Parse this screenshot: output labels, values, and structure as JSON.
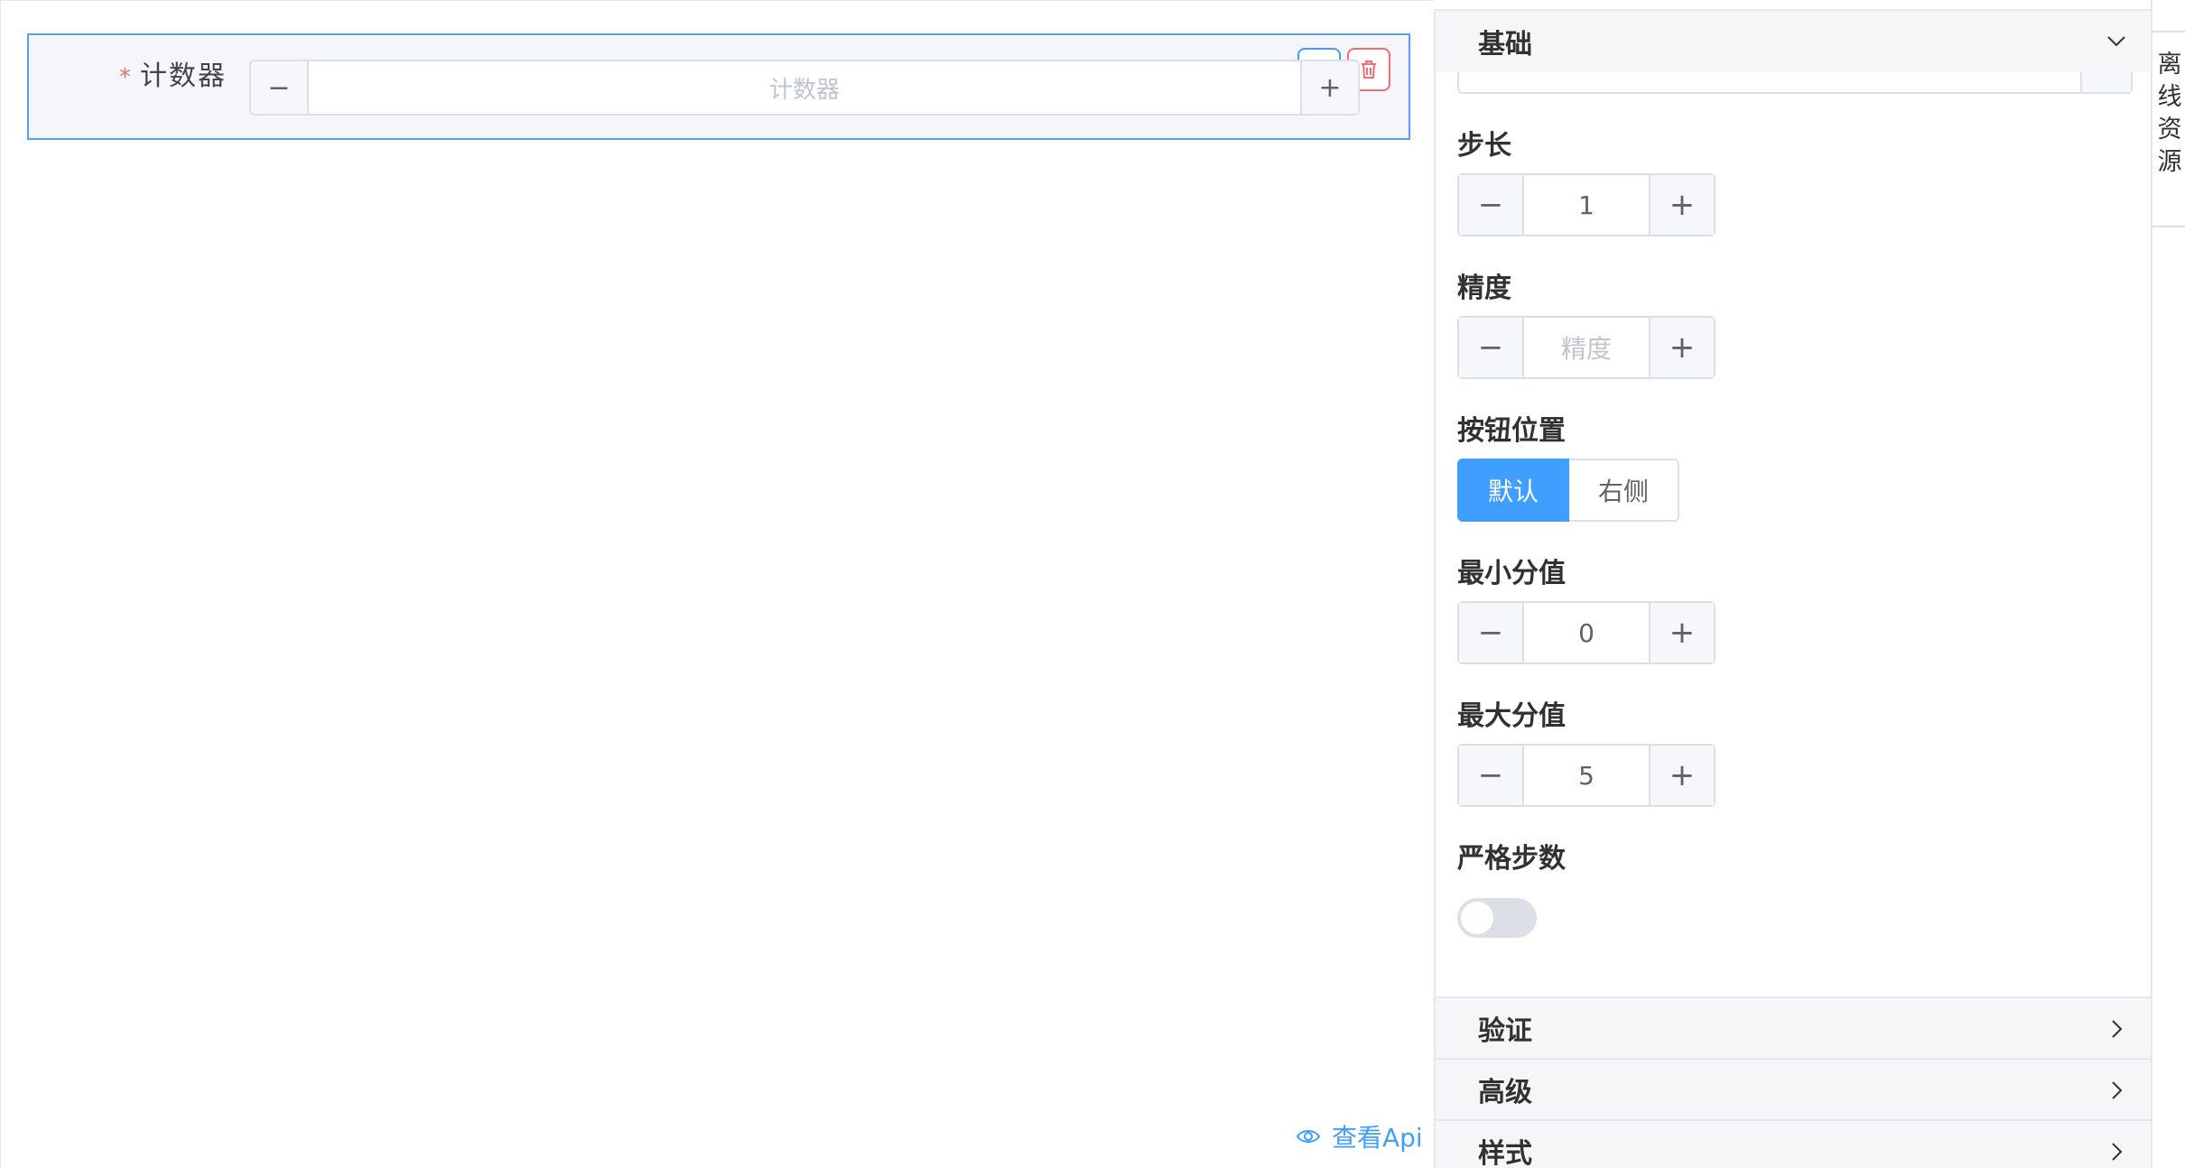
{
  "canvas": {
    "field": {
      "label": "计数器",
      "required_mark": "*",
      "placeholder": "计数器",
      "minus": "−",
      "plus": "+"
    },
    "view_api_label": "查看Api"
  },
  "panel": {
    "sections": {
      "basic": "基础",
      "validate": "验证",
      "advanced": "高级",
      "style": "样式"
    },
    "step": {
      "label": "步长",
      "value": "1"
    },
    "precision": {
      "label": "精度",
      "placeholder": "精度"
    },
    "button_position": {
      "label": "按钮位置",
      "options": [
        "默认",
        "右侧"
      ],
      "selected": "默认"
    },
    "min_value": {
      "label": "最小分值",
      "value": "0"
    },
    "max_value": {
      "label": "最大分值",
      "value": "5"
    },
    "strict_step": {
      "label": "严格步数",
      "enabled": false
    },
    "stepper_minus": "−",
    "stepper_plus": "+"
  },
  "sidebar": {
    "offline_resources": [
      "离",
      "线",
      "资",
      "源"
    ]
  },
  "colors": {
    "primary": "#409eff",
    "danger": "#f56c6c",
    "selection_border": "#5c9cf3"
  }
}
